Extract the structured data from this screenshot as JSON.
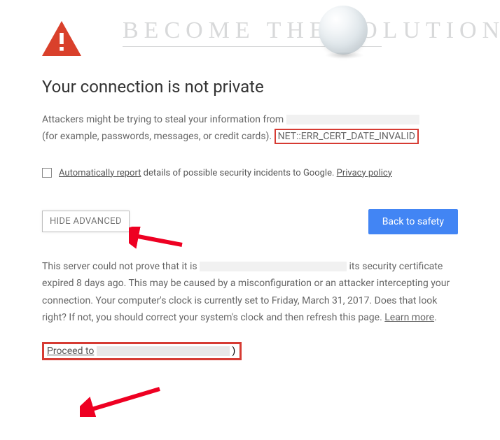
{
  "watermark": "BECOME THE SOLUTION",
  "title": "Your connection is not private",
  "warning": {
    "line1": "Attackers might be trying to steal your information from",
    "line2_prefix": "(for example, passwords, messages, or credit cards).",
    "error_code": "NET::ERR_CERT_DATE_INVALID"
  },
  "report": {
    "auto_label": "Automatically report",
    "details_label": " details of possible security incidents to Google. ",
    "privacy_label": "Privacy policy"
  },
  "buttons": {
    "hide_advanced": "HIDE ADVANCED",
    "back_to_safety": "Back to safety"
  },
  "explanation": {
    "part1": "This server could not prove that it is ",
    "part2": " its security certificate expired 8 days ago. This may be caused by a misconfiguration or an attacker intercepting your connection. Your computer's clock is currently set to Friday, March 31, 2017. Does that look right? If not, you should correct your system's clock and then refresh this page. ",
    "learn_more": "Learn more"
  },
  "proceed": {
    "label": "Proceed to",
    "suffix": ")"
  }
}
